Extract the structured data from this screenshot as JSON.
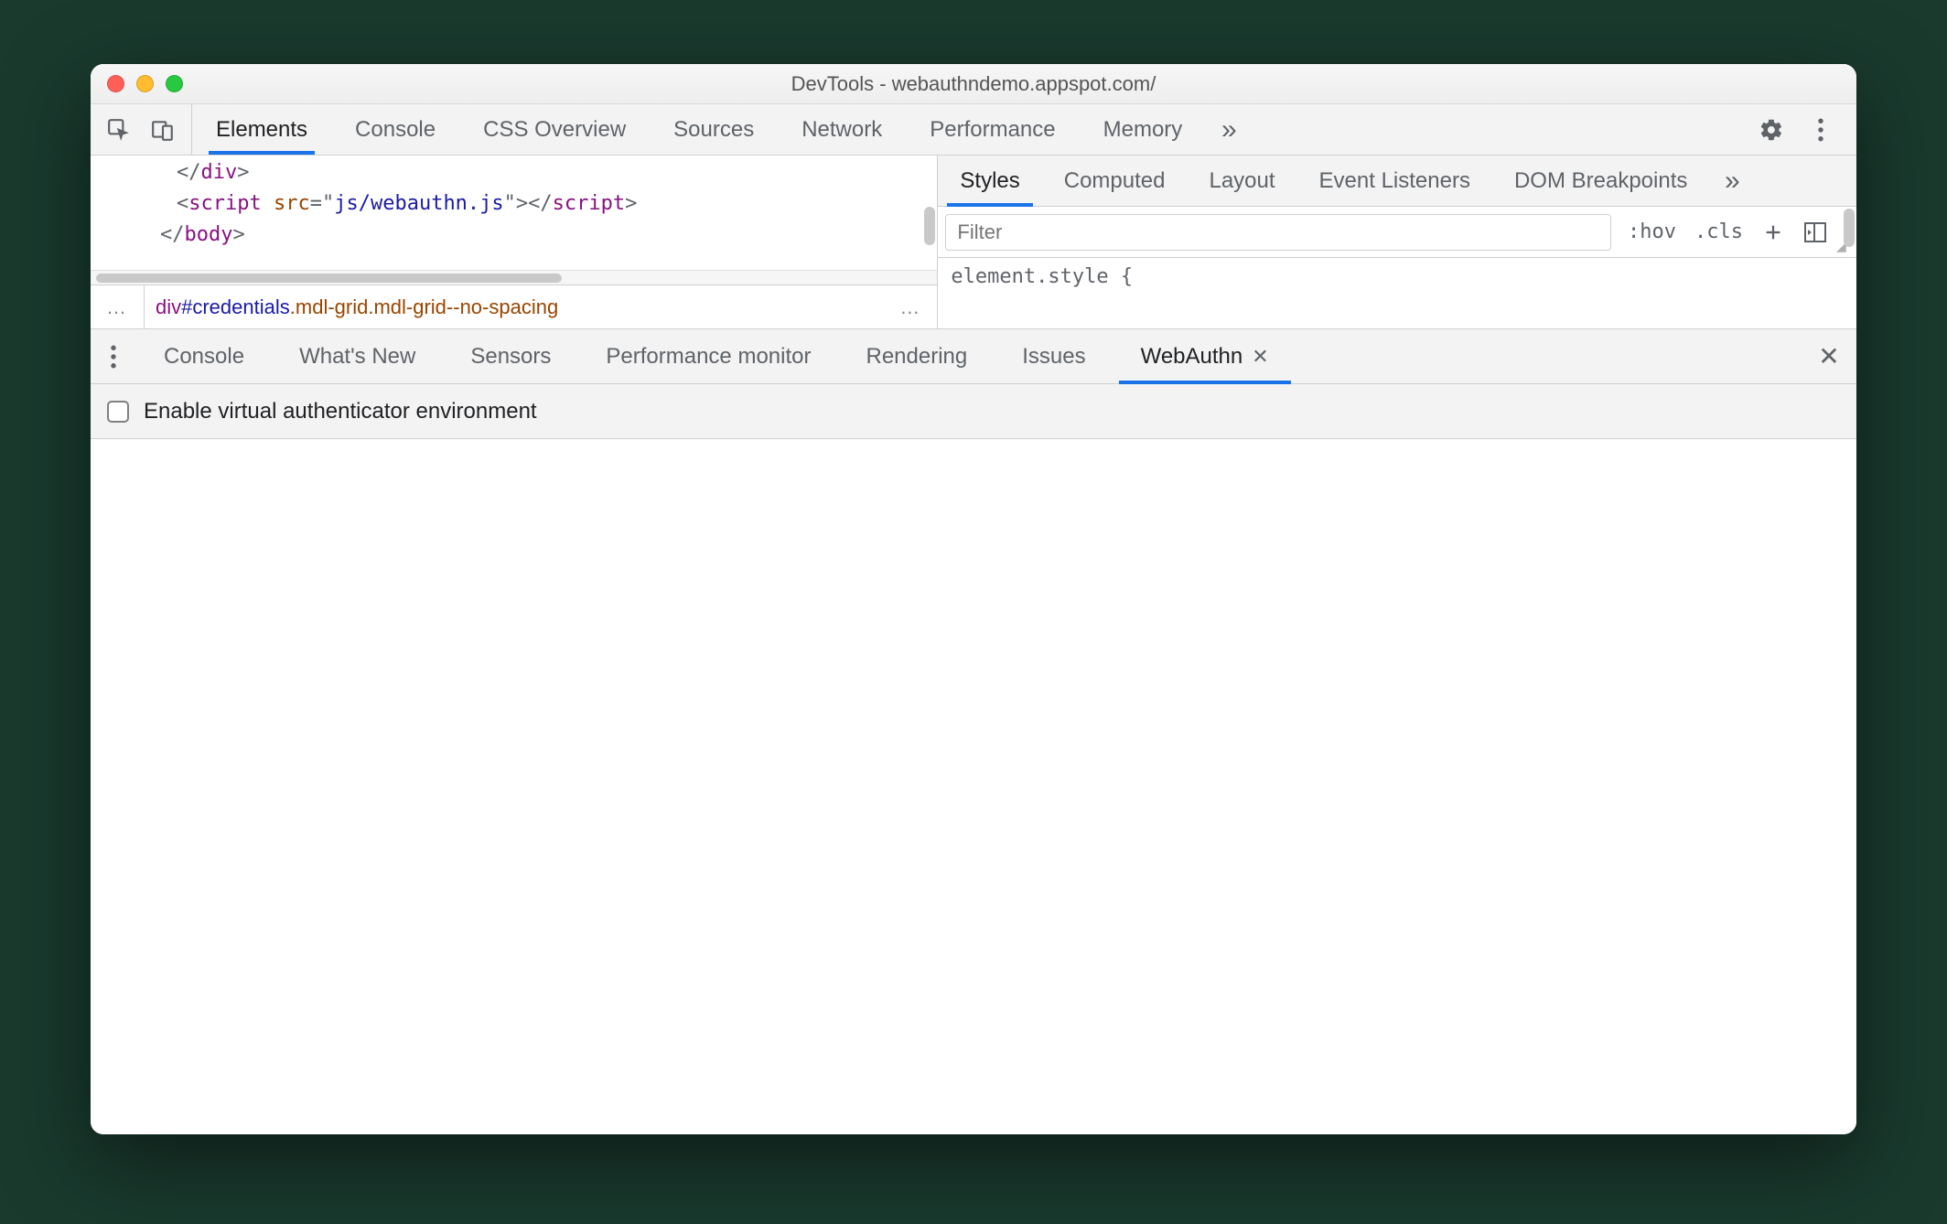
{
  "window": {
    "title": "DevTools - webauthndemo.appspot.com/"
  },
  "main_tabs": {
    "items": [
      "Elements",
      "Console",
      "CSS Overview",
      "Sources",
      "Network",
      "Performance",
      "Memory"
    ],
    "active_index": 0,
    "overflow_glyph": "»"
  },
  "code": {
    "lines": [
      {
        "indent": 3,
        "parts": [
          {
            "t": "punc",
            "v": "</"
          },
          {
            "t": "tag",
            "v": "div"
          },
          {
            "t": "punc",
            "v": ">"
          }
        ]
      },
      {
        "indent": 3,
        "parts": [
          {
            "t": "punc",
            "v": "<"
          },
          {
            "t": "tag",
            "v": "script"
          },
          {
            "t": "plain",
            "v": " "
          },
          {
            "t": "attr",
            "v": "src"
          },
          {
            "t": "punc",
            "v": "=\""
          },
          {
            "t": "val",
            "v": "js/webauthn.js"
          },
          {
            "t": "punc",
            "v": "\">"
          },
          {
            "t": "punc",
            "v": "</"
          },
          {
            "t": "tag",
            "v": "script"
          },
          {
            "t": "punc",
            "v": ">"
          }
        ]
      },
      {
        "indent": 2,
        "parts": [
          {
            "t": "punc",
            "v": "</"
          },
          {
            "t": "tag",
            "v": "body"
          },
          {
            "t": "punc",
            "v": ">"
          }
        ]
      }
    ]
  },
  "breadcrumb": {
    "ellipsis": "…",
    "tag": "div",
    "id": "#credentials",
    "class_suffix": ".mdl-grid.mdl-grid--no-spacing",
    "trailing_ellipsis": "…"
  },
  "styles": {
    "tabs": [
      "Styles",
      "Computed",
      "Layout",
      "Event Listeners",
      "DOM Breakpoints"
    ],
    "active_index": 0,
    "overflow_glyph": "»",
    "filter_placeholder": "Filter",
    "hov": ":hov",
    "cls": ".cls",
    "element_style": "element.style {"
  },
  "drawer": {
    "tabs": [
      "Console",
      "What's New",
      "Sensors",
      "Performance monitor",
      "Rendering",
      "Issues",
      "WebAuthn"
    ],
    "active_index": 6
  },
  "webauthn": {
    "checkbox_label": "Enable virtual authenticator environment",
    "checked": false
  }
}
